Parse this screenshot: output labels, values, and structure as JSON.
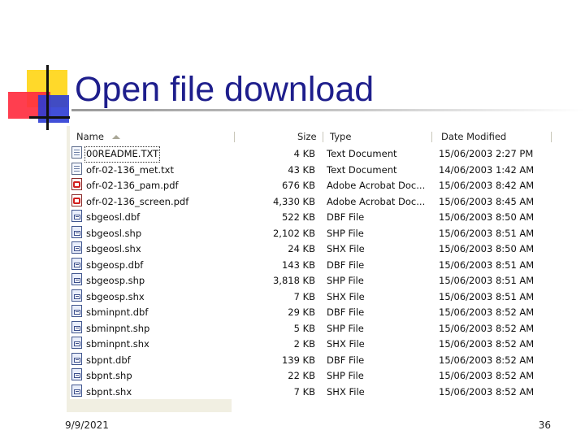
{
  "slide": {
    "title": "Open file download",
    "footer_date": "9/9/2021",
    "page_number": "36"
  },
  "explorer": {
    "columns": {
      "name": "Name",
      "size": "Size",
      "type": "Type",
      "date": "Date Modified"
    },
    "sort": {
      "column": "Name",
      "direction": "ascending"
    },
    "files": [
      {
        "name": "00README.TXT",
        "size": "4 KB",
        "type": "Text Document",
        "date": "15/06/2003 2:27 PM",
        "icon": "text-file-icon"
      },
      {
        "name": "ofr-02-136_met.txt",
        "size": "43 KB",
        "type": "Text Document",
        "date": "14/06/2003 1:42 AM",
        "icon": "text-file-icon"
      },
      {
        "name": "ofr-02-136_pam.pdf",
        "size": "676 KB",
        "type": "Adobe Acrobat Doc...",
        "date": "15/06/2003 8:42 AM",
        "icon": "pdf-file-icon"
      },
      {
        "name": "ofr-02-136_screen.pdf",
        "size": "4,330 KB",
        "type": "Adobe Acrobat Doc...",
        "date": "15/06/2003 8:45 AM",
        "icon": "pdf-file-icon"
      },
      {
        "name": "sbgeosl.dbf",
        "size": "522 KB",
        "type": "DBF File",
        "date": "15/06/2003 8:50 AM",
        "icon": "generic-file-icon"
      },
      {
        "name": "sbgeosl.shp",
        "size": "2,102 KB",
        "type": "SHP File",
        "date": "15/06/2003 8:51 AM",
        "icon": "generic-file-icon"
      },
      {
        "name": "sbgeosl.shx",
        "size": "24 KB",
        "type": "SHX File",
        "date": "15/06/2003 8:50 AM",
        "icon": "generic-file-icon"
      },
      {
        "name": "sbgeosp.dbf",
        "size": "143 KB",
        "type": "DBF File",
        "date": "15/06/2003 8:51 AM",
        "icon": "generic-file-icon"
      },
      {
        "name": "sbgeosp.shp",
        "size": "3,818 KB",
        "type": "SHP File",
        "date": "15/06/2003 8:51 AM",
        "icon": "generic-file-icon"
      },
      {
        "name": "sbgeosp.shx",
        "size": "7 KB",
        "type": "SHX File",
        "date": "15/06/2003 8:51 AM",
        "icon": "generic-file-icon"
      },
      {
        "name": "sbminpnt.dbf",
        "size": "29 KB",
        "type": "DBF File",
        "date": "15/06/2003 8:52 AM",
        "icon": "generic-file-icon"
      },
      {
        "name": "sbminpnt.shp",
        "size": "5 KB",
        "type": "SHP File",
        "date": "15/06/2003 8:52 AM",
        "icon": "generic-file-icon"
      },
      {
        "name": "sbminpnt.shx",
        "size": "2 KB",
        "type": "SHX File",
        "date": "15/06/2003 8:52 AM",
        "icon": "generic-file-icon"
      },
      {
        "name": "sbpnt.dbf",
        "size": "139 KB",
        "type": "DBF File",
        "date": "15/06/2003 8:52 AM",
        "icon": "generic-file-icon"
      },
      {
        "name": "sbpnt.shp",
        "size": "22 KB",
        "type": "SHP File",
        "date": "15/06/2003 8:52 AM",
        "icon": "generic-file-icon"
      },
      {
        "name": "sbpnt.shx",
        "size": "7 KB",
        "type": "SHX File",
        "date": "15/06/2003 8:52 AM",
        "icon": "generic-file-icon"
      }
    ]
  },
  "colors": {
    "title": "#1e1e8c",
    "deco_yellow": "#ffd92a",
    "deco_red": "#ff2e40",
    "deco_blue": "#2c3cd4"
  }
}
